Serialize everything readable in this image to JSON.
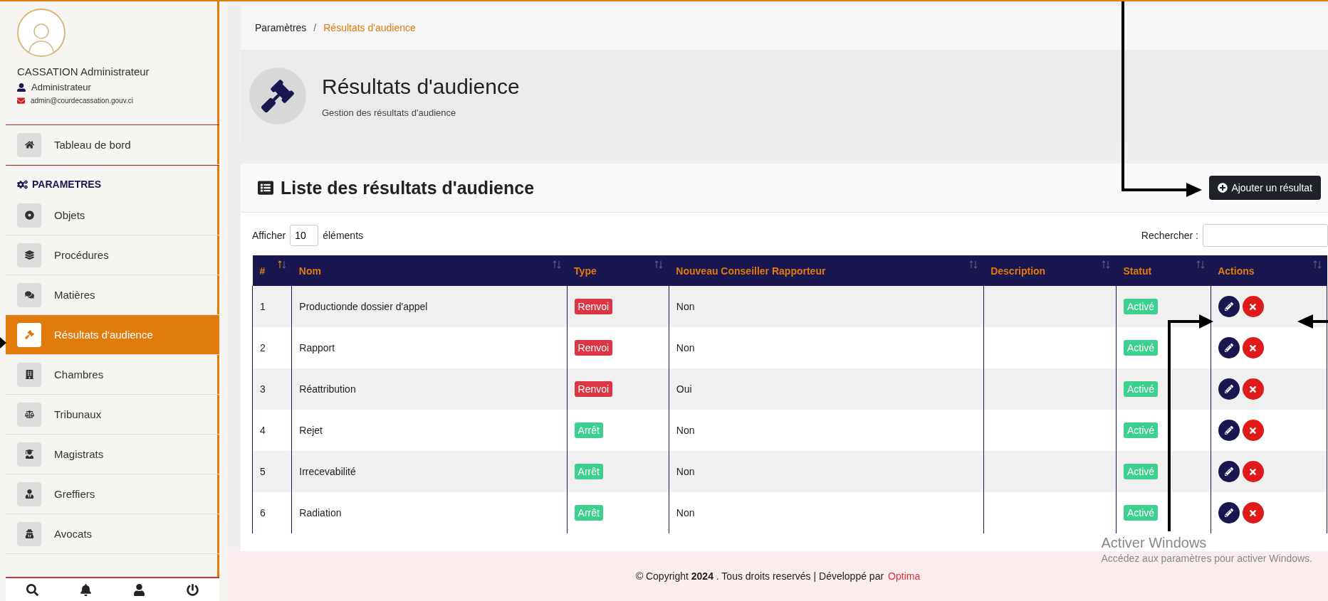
{
  "sidebar": {
    "profile": {
      "name": "CASSATION Administrateur",
      "role": "Administrateur",
      "email": "admin@courdecassation.gouv.ci"
    },
    "dashboard": {
      "label": "Tableau de bord",
      "selected": false
    },
    "section_title": "PARAMETRES",
    "items": [
      {
        "label": "Objets",
        "selected": false
      },
      {
        "label": "Procédures",
        "selected": false
      },
      {
        "label": "Matières",
        "selected": false
      },
      {
        "label": "Résultats d'audience",
        "selected": true
      },
      {
        "label": "Chambres",
        "selected": false
      },
      {
        "label": "Tribunaux",
        "selected": false
      },
      {
        "label": "Magistrats",
        "selected": false
      },
      {
        "label": "Greffiers",
        "selected": false
      },
      {
        "label": "Avocats",
        "selected": false
      }
    ]
  },
  "breadcrumb_separator": "/",
  "breadcrumb": [
    {
      "label": "Paramètres",
      "selected": false
    },
    {
      "label": "Résultats d'audience",
      "selected": true
    }
  ],
  "page_header": {
    "title": "Résultats d'audience",
    "subtitle": "Gestion des résultats d'audience"
  },
  "card": {
    "title": "Liste des résultats d'audience",
    "add_button": "Ajouter un résultat",
    "length_label_before": "Afficher",
    "length_value": "10",
    "length_label_after": "éléments",
    "search_label": "Rechercher :",
    "table": {
      "columns": [
        {
          "label": "#",
          "sorted": true
        },
        {
          "label": "Nom",
          "sorted": false
        },
        {
          "label": "Type",
          "sorted": false
        },
        {
          "label": "Nouveau Conseiller Rapporteur",
          "sorted": false
        },
        {
          "label": "Description",
          "sorted": false
        },
        {
          "label": "Statut",
          "sorted": false
        },
        {
          "label": "Actions",
          "sorted": false
        }
      ],
      "rows": [
        {
          "number": "1",
          "name": "Productionde dossier d'appel",
          "type": {
            "label": "Renvoi",
            "color": "#dc3545"
          },
          "rapporteur": "Non",
          "status": "Activé"
        },
        {
          "number": "2",
          "name": "Rapport",
          "type": {
            "label": "Renvoi",
            "color": "#dc3545"
          },
          "rapporteur": "Non",
          "status": "Activé"
        },
        {
          "number": "3",
          "name": "Réattribution",
          "type": {
            "label": "Renvoi",
            "color": "#dc3545"
          },
          "rapporteur": "Oui",
          "status": "Activé"
        },
        {
          "number": "4",
          "name": "Rejet",
          "type": {
            "label": "Arrêt",
            "color": "#3dcf8e"
          },
          "rapporteur": "Non",
          "status": "Activé"
        },
        {
          "number": "5",
          "name": "Irrecevabilité",
          "type": {
            "label": "Arrêt",
            "color": "#3dcf8e"
          },
          "rapporteur": "Non",
          "status": "Activé"
        },
        {
          "number": "6",
          "name": "Radiation",
          "type": {
            "label": "Arrêt",
            "color": "#3dcf8e"
          },
          "rapporteur": "Non",
          "status": "Activé"
        }
      ]
    }
  },
  "footer": {
    "text": "© Copyright  **2024**  . Tous droits reservés | Développé par",
    "link": "Optima"
  },
  "os_notice": {
    "title": "Activer Windows",
    "text": "Accédez aux paramètres pour activer Windows."
  }
}
